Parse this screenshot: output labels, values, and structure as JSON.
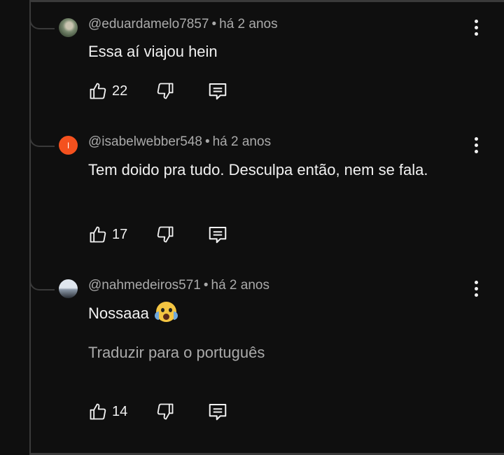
{
  "comments": [
    {
      "author": "@eduardamelo7857",
      "time": "há 2 anos",
      "text": "Essa aí viajou hein",
      "likes": "22",
      "avatar_icon": "photo-avatar"
    },
    {
      "author": "@isabelwebber548",
      "time": "há 2 anos",
      "text": "Tem doido pra tudo. Desculpa então, nem se fala.",
      "likes": "17",
      "avatar_letter": "I",
      "avatar_color": "#f4511e"
    },
    {
      "author": "@nahmedeiros571",
      "time": "há 2 anos",
      "text": "Nossaaa",
      "emoji": "screaming-face-emoji",
      "translate": "Traduzir para o português",
      "likes": "14",
      "avatar_icon": "photo-avatar"
    }
  ],
  "separator": "•",
  "icons": {
    "like": "thumbs-up-icon",
    "dislike": "thumbs-down-icon",
    "reply": "comment-icon",
    "menu": "more-vertical-icon"
  },
  "colors": {
    "background": "#0f0f0f",
    "text": "#f1f1f1",
    "secondary": "#aaaaaa",
    "thread": "#3a3a3a"
  }
}
